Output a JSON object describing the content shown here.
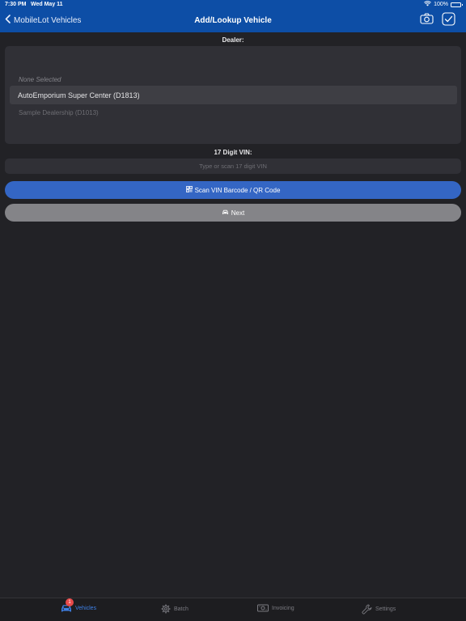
{
  "status_bar": {
    "time": "7:30 PM",
    "date": "Wed May 11",
    "battery": "100%"
  },
  "nav": {
    "back_label": "MobileLot Vehicles",
    "title": "Add/Lookup Vehicle"
  },
  "dealer": {
    "label": "Dealer:",
    "options": [
      "None Selected",
      "AutoEmporium Super Center (D1813)",
      "Sample Dealership (D1013)"
    ],
    "selected": "AutoEmporium Super Center (D1813)"
  },
  "vin": {
    "label": "17 Digit VIN:",
    "value": "",
    "placeholder": "Type or scan 17 digit VIN"
  },
  "buttons": {
    "scan": "Scan VIN Barcode / QR Code",
    "next": "Next"
  },
  "tabs": [
    {
      "label": "Vehicles",
      "icon": "car-icon",
      "badge": "1",
      "active": true
    },
    {
      "label": "Batch",
      "icon": "gear-icon",
      "active": false
    },
    {
      "label": "Invoicing",
      "icon": "invoice-icon",
      "active": false
    },
    {
      "label": "Settings",
      "icon": "wrench-icon",
      "active": false
    }
  ],
  "colors": {
    "brand_blue": "#0d4ea6",
    "scan_button": "#3466c4",
    "next_button": "#848488",
    "background": "#222226",
    "badge_red": "#e84a4a",
    "active_tab": "#3e80e6"
  }
}
